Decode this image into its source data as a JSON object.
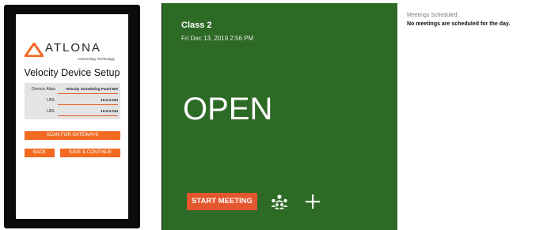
{
  "setup": {
    "brand": {
      "name": "ATLONA",
      "tagline": "Connecting Technology"
    },
    "title": "Velocity Device Setup",
    "fields": [
      {
        "label": "Device Alias",
        "value": "Velocity Scheduling Panel 800"
      },
      {
        "label": "URL",
        "value": "10.0.0.234"
      },
      {
        "label": "URL",
        "value": "10.0.0.234"
      }
    ],
    "scan_label": "SCAN FOR GATEWAYS",
    "back_label": "BACK",
    "save_label": "SAVE & CONTINUE",
    "accent_color": "#f36a21"
  },
  "room": {
    "name": "Class 2",
    "datetime": "Fri Dec 13, 2019 2:56 PM",
    "status": "OPEN",
    "start_label": "START MEETING",
    "status_color": "#2d6a25",
    "icons": [
      "people-icon",
      "plus-icon"
    ]
  },
  "schedule": {
    "heading": "Meetings Scheduled",
    "empty_message": "No meetings are scheduled for the day."
  }
}
